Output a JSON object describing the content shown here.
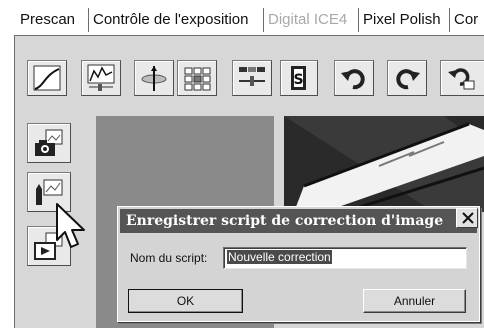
{
  "tabs": [
    {
      "label": "Prescan",
      "state": "active"
    },
    {
      "label": "Contrôle de l'exposition",
      "state": "normal"
    },
    {
      "label": "Digital ICE4",
      "state": "disabled"
    },
    {
      "label": "Pixel Polish",
      "state": "normal"
    },
    {
      "label": "Cor",
      "state": "normal"
    }
  ],
  "toolbar": {
    "icons": [
      "tone-curve-icon",
      "levels-histogram-icon",
      "hue-wheel-icon",
      "grid-variations-icon",
      "color-balance-slider-icon",
      "save-script-icon",
      "undo-icon",
      "redo-icon",
      "reset-icon"
    ]
  },
  "side_buttons": {
    "icons": [
      "camera-snapshot-icon",
      "save-correction-script-icon",
      "load-job-icon"
    ]
  },
  "dialog": {
    "title": "Enregistrer script de correction d'image",
    "field_label": "Nom du script:",
    "field_value": "Nouvelle correction",
    "ok_label": "OK",
    "cancel_label": "Annuler"
  },
  "colors": {
    "panel": "#d7d7d7",
    "title_bar": "#555555",
    "preview_bg": "#8a8a8a"
  }
}
